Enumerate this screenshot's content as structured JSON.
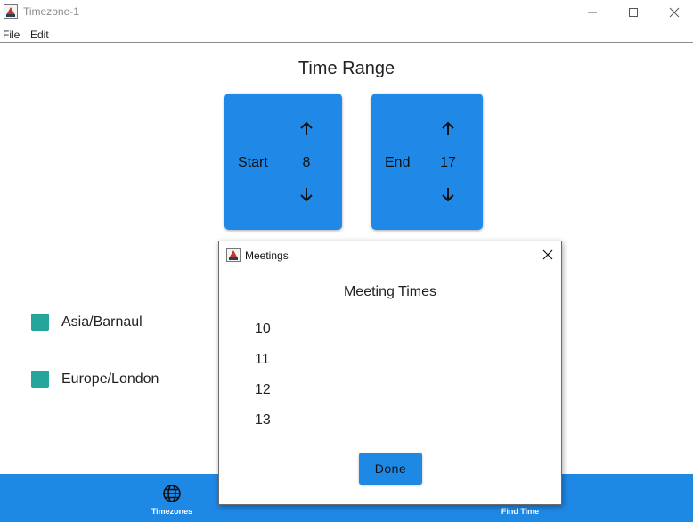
{
  "window": {
    "title": "Timezone-1"
  },
  "menu": {
    "file": "File",
    "edit": "Edit"
  },
  "main": {
    "title": "Time Range",
    "start": {
      "label": "Start",
      "value": "8"
    },
    "end": {
      "label": "End",
      "value": "17"
    },
    "timezones": [
      {
        "name": "Asia/Barnaul",
        "color": "#26a69a"
      },
      {
        "name": "Europe/London",
        "color": "#26a69a"
      }
    ]
  },
  "bottom_nav": {
    "timezones_label": "Timezones",
    "find_time_label": "Find Time",
    "timezones_icon": "globe-icon"
  },
  "dialog": {
    "title": "Meetings",
    "heading": "Meeting Times",
    "times": [
      "10",
      "11",
      "12",
      "13"
    ],
    "done_label": "Done"
  },
  "colors": {
    "accent": "#1e88e5",
    "card": "#2089e8",
    "swatch": "#26a69a"
  }
}
